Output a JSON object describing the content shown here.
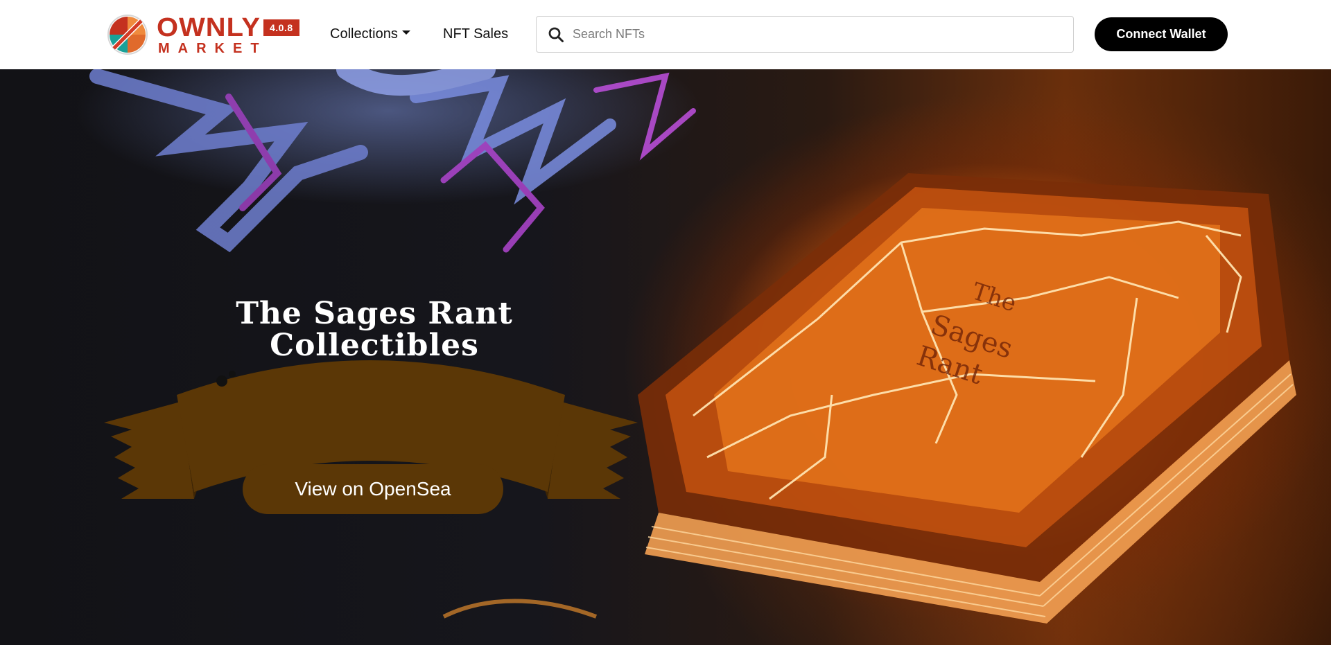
{
  "navbar": {
    "brand": {
      "name": "OWNLY",
      "sub": "MARKET",
      "version": "4.0.8"
    },
    "links": {
      "collections": "Collections",
      "nft_sales": "NFT Sales"
    },
    "search": {
      "placeholder": "Search NFTs",
      "value": ""
    },
    "connect_wallet": "Connect Wallet"
  },
  "hero": {
    "title": "The Sages Rant Collectibles",
    "cta": "View on OpenSea",
    "banner_color": "#5b3706",
    "artwork": "glowing-spellbook-illustration"
  },
  "colors": {
    "brand_red": "#c4311f",
    "brand_teal": "#1aa198",
    "brand_orange": "#ef8a3d",
    "button_black": "#000000"
  }
}
